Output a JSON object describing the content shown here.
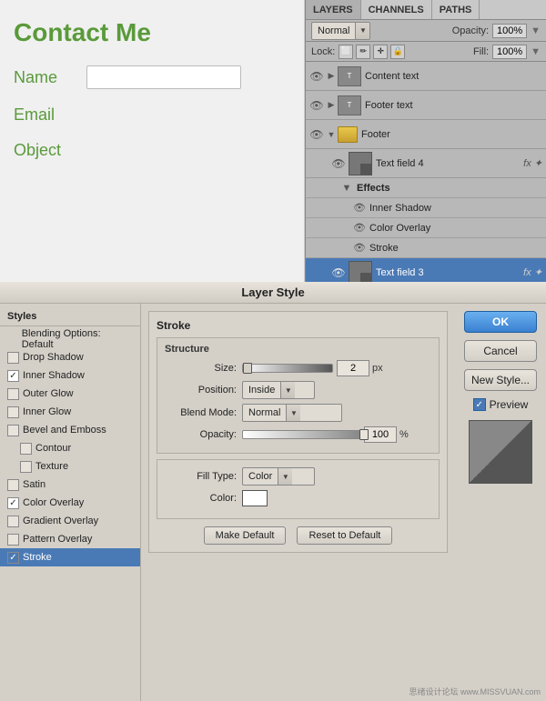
{
  "layers_panel": {
    "tabs": [
      "LAYERS",
      "CHANNELS",
      "PATHS"
    ],
    "active_tab": "LAYERS",
    "blend_mode": "Normal",
    "opacity_label": "Opacity:",
    "opacity_value": "100%",
    "lock_label": "Lock:",
    "fill_label": "Fill:",
    "fill_value": "100%",
    "layers": [
      {
        "name": "Content text",
        "type": "text",
        "visible": true
      },
      {
        "name": "Footer text",
        "type": "text",
        "visible": true
      },
      {
        "name": "Footer",
        "type": "folder",
        "visible": true
      },
      {
        "name": "Text field 4",
        "type": "layer",
        "visible": true,
        "has_fx": true,
        "effects": [
          "Inner Shadow",
          "Color Overlay",
          "Stroke"
        ]
      },
      {
        "name": "Text field 3",
        "type": "layer",
        "visible": true,
        "has_fx": true,
        "selected": true
      }
    ]
  },
  "web_preview": {
    "title": "Contact Me",
    "fields": [
      {
        "label": "Name",
        "has_input": true
      },
      {
        "label": "Email",
        "has_input": false
      },
      {
        "label": "Object",
        "has_input": false
      }
    ]
  },
  "dialog": {
    "title": "Layer Style",
    "styles_title": "Styles",
    "style_items": [
      {
        "label": "Blending Options: Default",
        "checked": false,
        "is_header": true
      },
      {
        "label": "Drop Shadow",
        "checked": false
      },
      {
        "label": "Inner Shadow",
        "checked": true
      },
      {
        "label": "Outer Glow",
        "checked": false
      },
      {
        "label": "Inner Glow",
        "checked": false
      },
      {
        "label": "Bevel and Emboss",
        "checked": false
      },
      {
        "label": "Contour",
        "checked": false,
        "sub": true
      },
      {
        "label": "Texture",
        "checked": false,
        "sub": true
      },
      {
        "label": "Satin",
        "checked": false
      },
      {
        "label": "Color Overlay",
        "checked": true
      },
      {
        "label": "Gradient Overlay",
        "checked": false
      },
      {
        "label": "Pattern Overlay",
        "checked": false
      },
      {
        "label": "Stroke",
        "checked": true,
        "selected": true
      }
    ],
    "stroke": {
      "title": "Stroke",
      "structure_title": "Structure",
      "size_label": "Size:",
      "size_value": "2",
      "size_unit": "px",
      "position_label": "Position:",
      "position_value": "Inside",
      "blend_mode_label": "Blend Mode:",
      "blend_mode_value": "Normal",
      "opacity_label": "Opacity:",
      "opacity_value": "100",
      "opacity_unit": "%",
      "fill_type_label": "Fill Type:",
      "fill_type_value": "Color",
      "color_label": "Color:"
    },
    "buttons": {
      "make_default": "Make Default",
      "reset_to_default": "Reset to Default"
    },
    "right_buttons": {
      "ok": "OK",
      "cancel": "Cancel",
      "new_style": "New Style..."
    },
    "preview_label": "Preview"
  },
  "watermark": "思绪设计论坛 www.MISSVUAN.com"
}
